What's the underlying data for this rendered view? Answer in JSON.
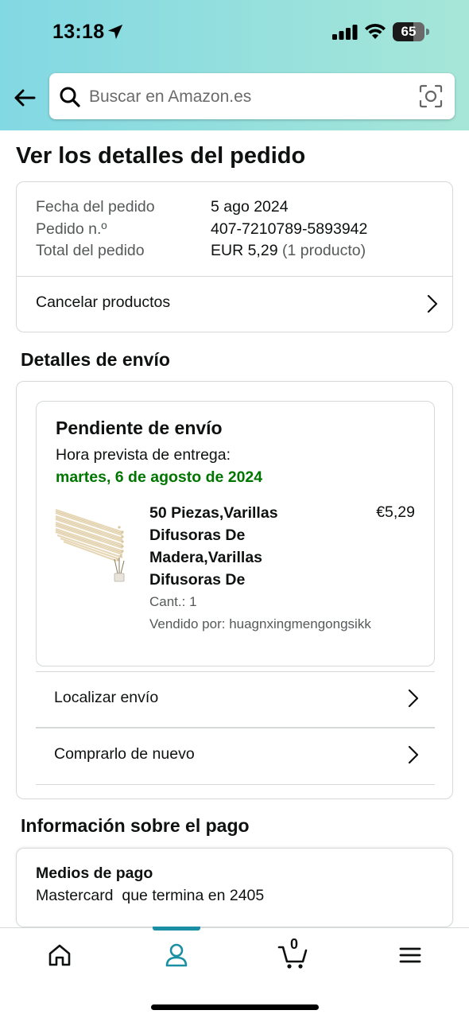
{
  "status_bar": {
    "time": "13:18",
    "battery": "65"
  },
  "search": {
    "placeholder": "Buscar en Amazon.es"
  },
  "page_title": "Ver los detalles del pedido",
  "order": {
    "date_label": "Fecha del pedido",
    "date_value": "5 ago 2024",
    "number_label": "Pedido n.º",
    "number_value": "407-7210789-5893942",
    "total_label": "Total del pedido",
    "total_value": "EUR 5,29",
    "total_count": "(1 producto)",
    "cancel_label": "Cancelar productos"
  },
  "shipping": {
    "section_title": "Detalles de envío",
    "status": "Pendiente de envío",
    "delivery_label": "Hora prevista de entrega:",
    "delivery_date": "martes, 6 de agosto de 2024",
    "delivery_color": "#007600",
    "product": {
      "title": "50 Piezas,Varillas Difusoras De Madera,Varillas Difusoras De",
      "price": "€5,29",
      "qty": "Cant.: 1",
      "seller": "Vendido por: huagnxingmengongsikk"
    },
    "track_label": "Localizar envío",
    "buy_again_label": "Comprarlo de nuevo"
  },
  "payment": {
    "section_title": "Información sobre el pago",
    "title": "Medios de pago",
    "method": "Mastercard  que termina en 2405"
  },
  "bottom_nav": {
    "cart_count": "0",
    "items": [
      "home-icon",
      "account-icon",
      "cart-icon",
      "menu-icon"
    ],
    "active_color": "#1a8fa3"
  }
}
